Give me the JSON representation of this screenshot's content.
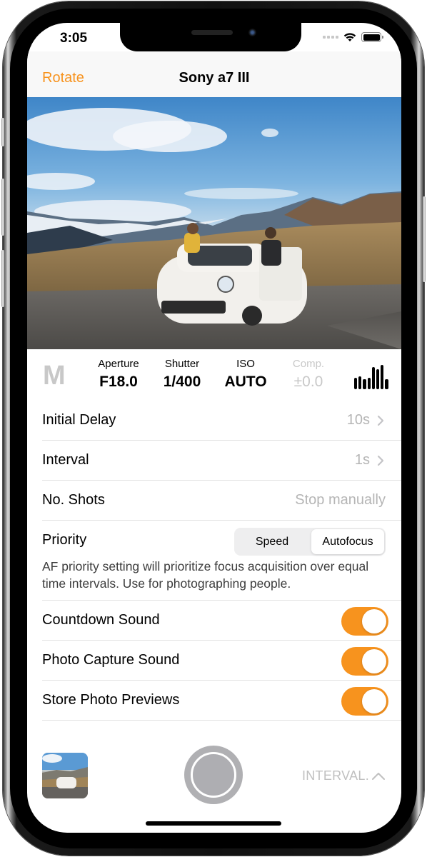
{
  "status_bar": {
    "time": "3:05",
    "icons": [
      "signal-dots-icon",
      "wifi-icon",
      "battery-icon"
    ]
  },
  "navbar": {
    "left_button": "Rotate",
    "title": "Sony a7 III"
  },
  "preview": {
    "description": "Live view: white car with two people on a mountain road under blue sky"
  },
  "exposure": {
    "mode": "M",
    "params": [
      {
        "label": "Aperture",
        "value": "F18.0",
        "enabled": true
      },
      {
        "label": "Shutter",
        "value": "1/400",
        "enabled": true
      },
      {
        "label": "ISO",
        "value": "AUTO",
        "enabled": true
      },
      {
        "label": "Comp.",
        "value": "±0.0",
        "enabled": false
      }
    ],
    "histogram_icon": "histogram-icon",
    "histogram_levels": [
      0.45,
      0.5,
      0.38,
      0.45,
      0.85,
      0.78,
      0.95,
      0.4
    ]
  },
  "settings": {
    "initial_delay": {
      "label": "Initial Delay",
      "value": "10s"
    },
    "interval": {
      "label": "Interval",
      "value": "1s"
    },
    "no_shots": {
      "label": "No. Shots",
      "value": "Stop manually"
    },
    "priority": {
      "label": "Priority",
      "options": [
        "Speed",
        "Autofocus"
      ],
      "selected": "Autofocus",
      "description": "AF priority setting will prioritize focus acquisition over equal time intervals. Use for photographing people."
    },
    "countdown_sound": {
      "label": "Countdown Sound",
      "on": true
    },
    "photo_capture_sound": {
      "label": "Photo Capture Sound",
      "on": true
    },
    "store_photo_previews": {
      "label": "Store Photo Previews",
      "on": true
    }
  },
  "bottom_bar": {
    "mode_label": "INTERVAL.",
    "mode_icon": "chevron-up-icon"
  },
  "colors": {
    "accent": "#f7931e",
    "secondary_text": "#b5b5b5",
    "disabled": "#c8c8c8"
  }
}
